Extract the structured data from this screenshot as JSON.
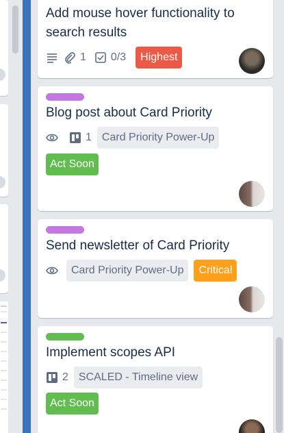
{
  "cards": [
    {
      "title_line1": "Add mouse hover functionality to",
      "title_line2": "search results",
      "attachments": "1",
      "checklist": "0/3",
      "priority": "Highest",
      "priority_color": "#eb5a46"
    },
    {
      "label_color": "#c377e0",
      "title": "Blog post about Card Priority",
      "board_count": "1",
      "powerup": "Card Priority Power-Up",
      "tag": "Act Soon",
      "tag_color": "#61bd4f"
    },
    {
      "label_color": "#c377e0",
      "title": "Send newsletter of Card Priority",
      "powerup": "Card Priority Power-Up",
      "priority": "Critical",
      "priority_color": "#ff9f1a"
    },
    {
      "label_color": "#61bd4f",
      "title": "Implement scopes API",
      "board_count": "2",
      "powerup": "SCALED - Timeline view",
      "tag": "Act Soon",
      "tag_color": "#61bd4f"
    }
  ],
  "icons": [
    "description-icon",
    "attachment-icon",
    "checklist-icon",
    "watch-eye-icon",
    "board-icon"
  ]
}
